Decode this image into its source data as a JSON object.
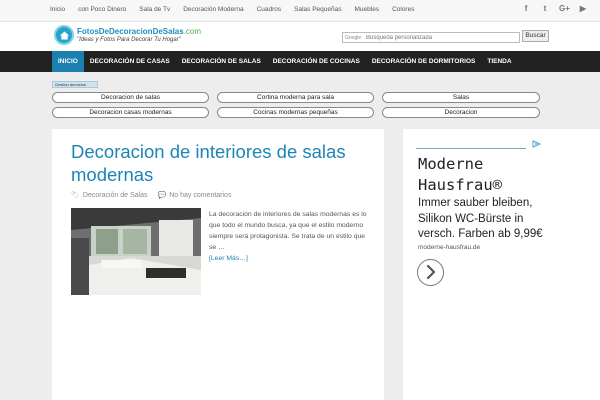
{
  "topbar": {
    "links": [
      "Inicio",
      "con Poco Dinero",
      "Sala de Tv",
      "Decoración Moderna",
      "Cuadros",
      "Salas Pequeñas",
      "Muebles",
      "Colores"
    ],
    "social": [
      {
        "name": "facebook-icon",
        "glyph": "f"
      },
      {
        "name": "twitter-icon",
        "glyph": "t"
      },
      {
        "name": "google-plus-icon",
        "glyph": "G+"
      },
      {
        "name": "youtube-icon",
        "glyph": "▶"
      }
    ]
  },
  "header": {
    "site_name": "FotosDeDecoracionDeSalas",
    "site_suffix": ".com",
    "tagline": "\"Ideas y Fotos Para Decorar Tu Hogar\"",
    "search_brand": "Google",
    "search_placeholder": "Búsqueda personalizada",
    "search_button": "Buscar"
  },
  "nav": {
    "items": [
      "INICIO",
      "DECORACIÓN DE CASAS",
      "DECORACIÓN DE SALAS",
      "DECORACIÓN DE COCINAS",
      "DECORACIÓN DE DORMITORIOS",
      "TIENDA"
    ]
  },
  "ad_links": {
    "label": "Gestión anuncios",
    "row1": [
      "Decoracion de salas",
      "Cortina moderna para sala",
      "Salas"
    ],
    "row2": [
      "Decoracion casas modernas",
      "Cocinas modernas pequeñas",
      "Decoracion"
    ]
  },
  "article": {
    "title": "Decoracion de interiores de salas modernas",
    "category": "Decoración de Salas",
    "comments": "No hay comentarios",
    "excerpt": "La decoración de interiores de salas modernas es lo que todo el mundo busca, ya que el estilo moderno siempre será protagonista. Se trata de un estilo que se …",
    "read_more": "[Leer Más…]"
  },
  "sidebar_ad": {
    "headline_line1": "Moderne",
    "headline_line2": "Hausfrau®",
    "body_line1": "Immer sauber bleiben,",
    "body_line2": "Silikon WC-Bürste in",
    "body_line3": "versch. Farben ab 9,99€",
    "url": "moderne-hausfrau.de"
  },
  "colors": {
    "accent": "#1d85b6",
    "nav_bg": "#222222",
    "nav_active": "#1b7fb0",
    "page_bg": "#ededed"
  }
}
